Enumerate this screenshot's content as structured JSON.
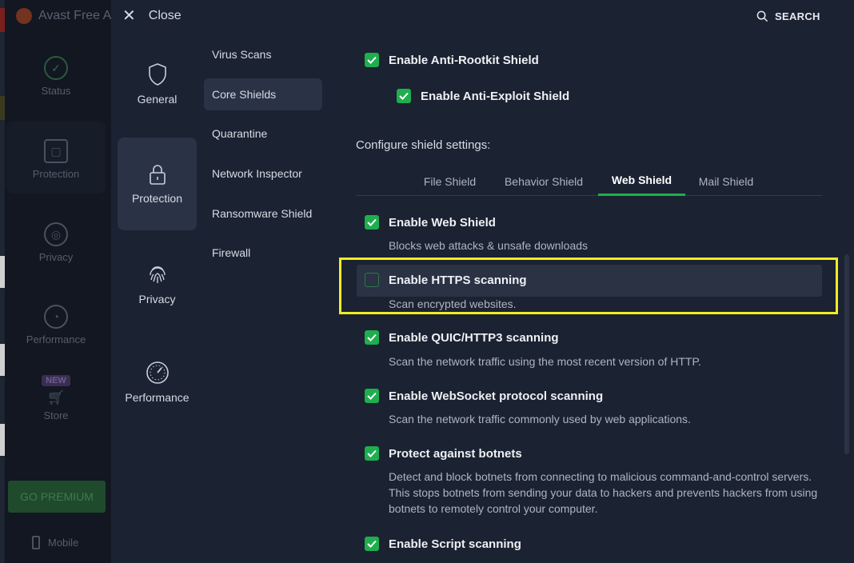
{
  "app": {
    "title": "Avast Free A"
  },
  "bg_nav": {
    "status": "Status",
    "protection": "Protection",
    "privacy": "Privacy",
    "performance": "Performance",
    "new_badge": "NEW",
    "store": "Store",
    "premium": "GO PREMIUM",
    "mobile": "Mobile"
  },
  "header": {
    "close_label": "Close",
    "search_label": "SEARCH"
  },
  "categories": [
    {
      "label": "General",
      "icon": "shield-icon"
    },
    {
      "label": "Protection",
      "icon": "lock-icon"
    },
    {
      "label": "Privacy",
      "icon": "fingerprint-icon"
    },
    {
      "label": "Performance",
      "icon": "gauge-icon"
    }
  ],
  "submenu": [
    "Virus Scans",
    "Core Shields",
    "Quarantine",
    "Network Inspector",
    "Ransomware Shield",
    "Firewall"
  ],
  "top_options": {
    "anti_rootkit": "Enable Anti-Rootkit Shield",
    "anti_exploit": "Enable Anti-Exploit Shield"
  },
  "section_title": "Configure shield settings:",
  "tabs": [
    "File Shield",
    "Behavior Shield",
    "Web Shield",
    "Mail Shield"
  ],
  "options": [
    {
      "label": "Enable Web Shield",
      "desc": "Blocks web attacks & unsafe downloads",
      "checked": true
    },
    {
      "label": "Enable HTTPS scanning",
      "desc": "Scan encrypted websites.",
      "checked": false
    },
    {
      "label": "Enable QUIC/HTTP3 scanning",
      "desc": "Scan the network traffic using the most recent version of HTTP.",
      "checked": true
    },
    {
      "label": "Enable WebSocket protocol scanning",
      "desc": "Scan the network traffic commonly used by web applications.",
      "checked": true
    },
    {
      "label": "Protect against botnets",
      "desc": "Detect and block botnets from connecting to malicious command-and-control servers. This stops botnets from sending your data to hackers and prevents hackers from using botnets to remotely control your computer.",
      "checked": true
    },
    {
      "label": "Enable Script scanning",
      "desc": "",
      "checked": true
    }
  ],
  "colors": {
    "accent": "#1fae4f",
    "highlight": "#f2ec25",
    "background": "#1b2231"
  }
}
